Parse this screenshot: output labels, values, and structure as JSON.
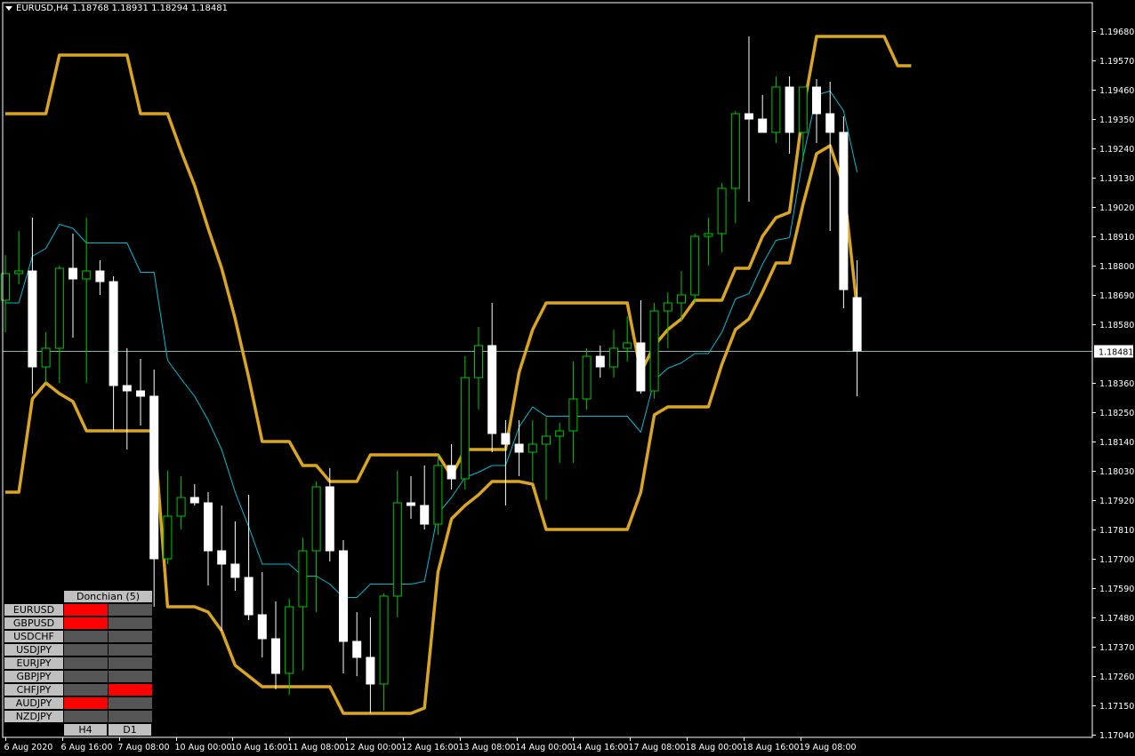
{
  "header": {
    "symbol_tf": "EURUSD,H4",
    "ohlc": "1.18768 1.18931 1.18294 1.18481"
  },
  "colors": {
    "background": "#000000",
    "grid_axis": "#ffffff",
    "bull_body": "#000000",
    "bull_wick": "#00c800",
    "bear_body": "#ffffff",
    "donchian": "#daa520",
    "middle": "#00bcd4",
    "price_line": "#7fb5b5",
    "signal_red": "#ff0000",
    "signal_gray": "#555555"
  },
  "chart_data": {
    "type": "candlestick",
    "ylim": [
      1.1699,
      1.1975
    ],
    "y_ticks": [
      "1.19680",
      "1.19570",
      "1.19460",
      "1.19350",
      "1.19240",
      "1.19130",
      "1.19020",
      "1.18910",
      "1.18800",
      "1.18690",
      "1.18580",
      "1.18360",
      "1.18250",
      "1.18140",
      "1.18030",
      "1.17920",
      "1.17810",
      "1.17700",
      "1.17590",
      "1.17480",
      "1.17370",
      "1.17260",
      "1.17150",
      "1.17040"
    ],
    "current_price": "1.18481",
    "x_labels": [
      "6 Aug 2020",
      "6 Aug 16:00",
      "7 Aug 08:00",
      "10 Aug 00:00",
      "10 Aug 16:00",
      "11 Aug 08:00",
      "12 Aug 00:00",
      "12 Aug 16:00",
      "13 Aug 08:00",
      "14 Aug 00:00",
      "14 Aug 16:00",
      "17 Aug 08:00",
      "18 Aug 00:00",
      "18 Aug 16:00",
      "19 Aug 08:00"
    ],
    "candles": [
      [
        1.1867,
        1.1884,
        1.1855,
        1.1877
      ],
      [
        1.1877,
        1.1893,
        1.1873,
        1.1878
      ],
      [
        1.1878,
        1.1898,
        1.1832,
        1.1842
      ],
      [
        1.1842,
        1.1855,
        1.1836,
        1.1849
      ],
      [
        1.1849,
        1.188,
        1.1836,
        1.1879
      ],
      [
        1.1879,
        1.1892,
        1.1853,
        1.1875
      ],
      [
        1.1875,
        1.1898,
        1.1836,
        1.1878
      ],
      [
        1.1878,
        1.1882,
        1.1869,
        1.1874
      ],
      [
        1.1874,
        1.1876,
        1.1818,
        1.1835
      ],
      [
        1.1835,
        1.1849,
        1.1811,
        1.1833
      ],
      [
        1.1833,
        1.1845,
        1.182,
        1.1831
      ],
      [
        1.1831,
        1.1841,
        1.1752,
        1.177
      ],
      [
        1.177,
        1.1803,
        1.1768,
        1.1786
      ],
      [
        1.1786,
        1.1801,
        1.1781,
        1.1793
      ],
      [
        1.1793,
        1.1798,
        1.179,
        1.1791
      ],
      [
        1.1791,
        1.1795,
        1.176,
        1.1773
      ],
      [
        1.1773,
        1.179,
        1.1743,
        1.1768
      ],
      [
        1.1768,
        1.1784,
        1.1758,
        1.1763
      ],
      [
        1.1763,
        1.1794,
        1.1747,
        1.1749
      ],
      [
        1.1749,
        1.1765,
        1.1733,
        1.174
      ],
      [
        1.174,
        1.1754,
        1.1721,
        1.1727
      ],
      [
        1.1727,
        1.1755,
        1.1719,
        1.1752
      ],
      [
        1.1752,
        1.1778,
        1.1728,
        1.1773
      ],
      [
        1.1773,
        1.1799,
        1.175,
        1.1797
      ],
      [
        1.1797,
        1.1804,
        1.1769,
        1.1773
      ],
      [
        1.1773,
        1.1777,
        1.1727,
        1.1739
      ],
      [
        1.1739,
        1.175,
        1.1726,
        1.1733
      ],
      [
        1.1733,
        1.1748,
        1.1712,
        1.1723
      ],
      [
        1.1723,
        1.1757,
        1.1713,
        1.1756
      ],
      [
        1.1756,
        1.1803,
        1.1748,
        1.1791
      ],
      [
        1.1791,
        1.1801,
        1.1785,
        1.179
      ],
      [
        1.179,
        1.1805,
        1.1781,
        1.1783
      ],
      [
        1.1783,
        1.1809,
        1.1779,
        1.1805
      ],
      [
        1.1805,
        1.1813,
        1.1796,
        1.18
      ],
      [
        1.18,
        1.1846,
        1.1796,
        1.1838
      ],
      [
        1.1838,
        1.1857,
        1.1826,
        1.185
      ],
      [
        1.185,
        1.1866,
        1.181,
        1.1817
      ],
      [
        1.1817,
        1.1822,
        1.179,
        1.1813
      ],
      [
        1.1813,
        1.1822,
        1.1801,
        1.181
      ],
      [
        1.181,
        1.1822,
        1.1799,
        1.1813
      ],
      [
        1.1813,
        1.1823,
        1.1792,
        1.1816
      ],
      [
        1.1816,
        1.1821,
        1.1806,
        1.1818
      ],
      [
        1.1818,
        1.1844,
        1.1806,
        1.183
      ],
      [
        1.183,
        1.1849,
        1.1826,
        1.1846
      ],
      [
        1.1846,
        1.185,
        1.1838,
        1.1842
      ],
      [
        1.1842,
        1.1856,
        1.1838,
        1.1849
      ],
      [
        1.1849,
        1.1861,
        1.1844,
        1.1851
      ],
      [
        1.1851,
        1.1867,
        1.1832,
        1.1833
      ],
      [
        1.1833,
        1.1866,
        1.183,
        1.1863
      ],
      [
        1.1863,
        1.187,
        1.1849,
        1.1866
      ],
      [
        1.1866,
        1.1878,
        1.1859,
        1.1869
      ],
      [
        1.1869,
        1.1892,
        1.1866,
        1.1891
      ],
      [
        1.1891,
        1.1898,
        1.188,
        1.1892
      ],
      [
        1.1892,
        1.1911,
        1.1885,
        1.1909
      ],
      [
        1.1909,
        1.1938,
        1.1896,
        1.1937
      ],
      [
        1.1937,
        1.1966,
        1.1904,
        1.1935
      ],
      [
        1.1935,
        1.1944,
        1.193,
        1.193
      ],
      [
        1.193,
        1.1951,
        1.1926,
        1.1947
      ],
      [
        1.1947,
        1.1951,
        1.1922,
        1.193
      ],
      [
        1.193,
        1.1947,
        1.1919,
        1.1947
      ],
      [
        1.1947,
        1.195,
        1.1926,
        1.1937
      ],
      [
        1.1937,
        1.1949,
        1.1893,
        1.193
      ],
      [
        1.193,
        1.1936,
        1.1864,
        1.1871
      ],
      [
        1.1868,
        1.1882,
        1.1831,
        1.1848
      ]
    ],
    "donchian_upper": [
      1.1937,
      1.1937,
      1.1937,
      1.1937,
      1.1959,
      1.1959,
      1.1959,
      1.1959,
      1.1959,
      1.1959,
      1.1937,
      1.1937,
      1.1937,
      1.1923,
      1.191,
      1.1894,
      1.1879,
      1.186,
      1.1838,
      1.1814,
      1.1814,
      1.1814,
      1.1805,
      1.1805,
      1.1799,
      1.1799,
      1.1799,
      1.1809,
      1.1809,
      1.1809,
      1.1809,
      1.1809,
      1.1809,
      1.1801,
      1.1811,
      1.1811,
      1.1811,
      1.1811,
      1.184,
      1.1856,
      1.1866,
      1.1866,
      1.1866,
      1.1866,
      1.1866,
      1.1866,
      1.1866,
      1.184,
      1.185,
      1.1856,
      1.186,
      1.1867,
      1.1867,
      1.1867,
      1.1879,
      1.1879,
      1.1891,
      1.1898,
      1.19,
      1.1938,
      1.1966,
      1.1966,
      1.1966,
      1.1966,
      1.1966,
      1.1966,
      1.1955,
      1.1955
    ],
    "donchian_lower": [
      1.1795,
      1.1795,
      1.183,
      1.1836,
      1.1832,
      1.1829,
      1.1818,
      1.1818,
      1.1818,
      1.1818,
      1.1818,
      1.1818,
      1.1752,
      1.1752,
      1.1752,
      1.175,
      1.1743,
      1.173,
      1.1726,
      1.1722,
      1.1722,
      1.1722,
      1.1722,
      1.1722,
      1.1722,
      1.1712,
      1.1712,
      1.1712,
      1.1712,
      1.1712,
      1.1712,
      1.1714,
      1.1765,
      1.1785,
      1.179,
      1.1794,
      1.1799,
      1.1799,
      1.1799,
      1.1798,
      1.1781,
      1.1781,
      1.1781,
      1.1781,
      1.1781,
      1.1781,
      1.1781,
      1.1795,
      1.1824,
      1.1827,
      1.1827,
      1.1827,
      1.1827,
      1.1843,
      1.1856,
      1.186,
      1.187,
      1.1881,
      1.1881,
      1.1903,
      1.1922,
      1.1925,
      1.191,
      1.1864
    ]
  },
  "panel": {
    "title": "Donchian (5)",
    "rows": [
      {
        "name": "EURUSD",
        "h4": "#ff0000",
        "d1": "#555555"
      },
      {
        "name": "GBPUSD",
        "h4": "#ff0000",
        "d1": "#555555"
      },
      {
        "name": "USDCHF",
        "h4": "#555555",
        "d1": "#555555"
      },
      {
        "name": "USDJPY",
        "h4": "#555555",
        "d1": "#555555"
      },
      {
        "name": "EURJPY",
        "h4": "#555555",
        "d1": "#555555"
      },
      {
        "name": "GBPJPY",
        "h4": "#555555",
        "d1": "#555555"
      },
      {
        "name": "CHFJPY",
        "h4": "#555555",
        "d1": "#ff0000"
      },
      {
        "name": "AUDJPY",
        "h4": "#ff0000",
        "d1": "#555555"
      },
      {
        "name": "NZDJPY",
        "h4": "#555555",
        "d1": "#555555"
      }
    ],
    "tf1": "H4",
    "tf2": "D1"
  }
}
